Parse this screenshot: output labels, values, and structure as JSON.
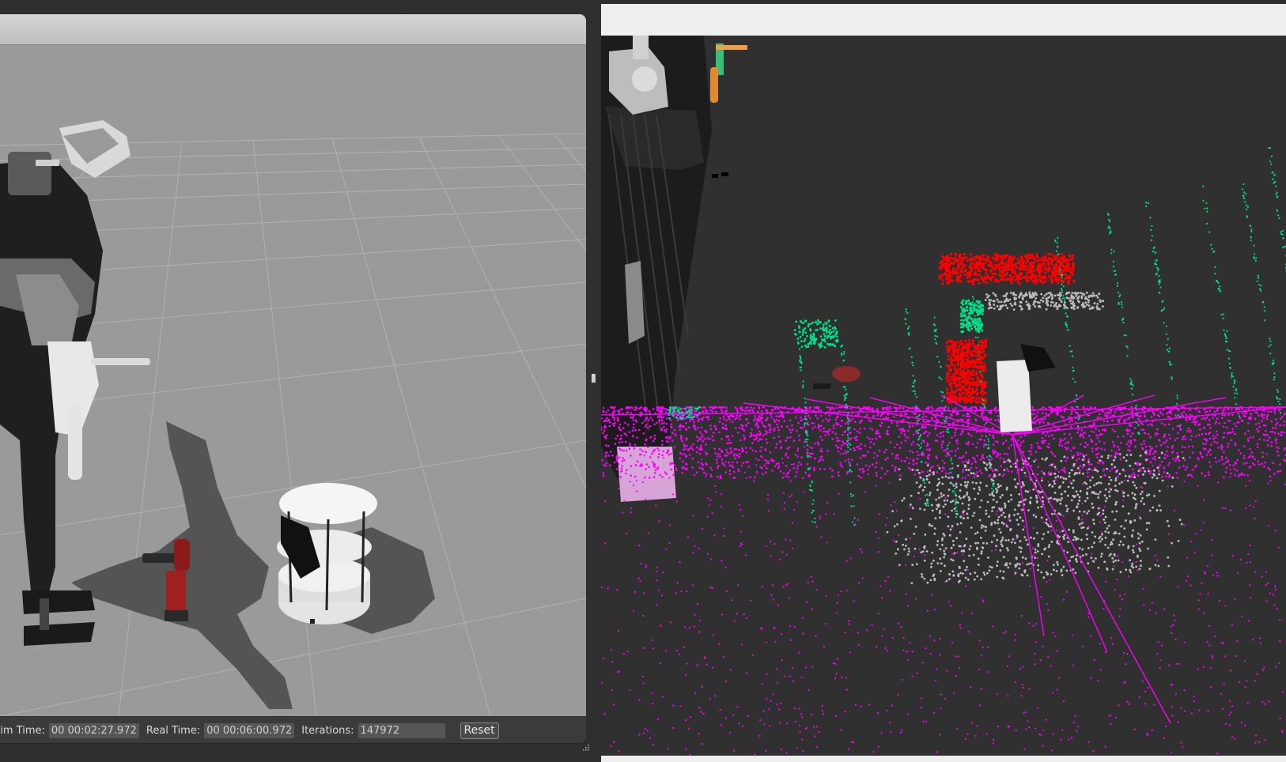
{
  "gazebo": {
    "status": {
      "sim_time_label": "Sim Time:",
      "sim_time_value": "00 00:02:27.972",
      "real_time_label": "Real Time:",
      "real_time_value": "00 00:06:00.972",
      "iterations_label": "Iterations:",
      "iterations_value": "147972",
      "reset_label": "Reset"
    }
  },
  "colors": {
    "ground_plane": "#9a9a9a",
    "rviz_background": "#303030",
    "ground_points": "#ff00ff",
    "obstacle_points": "#ff0000",
    "free_points": "#00e08a",
    "object_points": "#bdbdbd"
  },
  "icons": {
    "splitter": "vertical-dots-grip",
    "resize": "size-grip"
  }
}
